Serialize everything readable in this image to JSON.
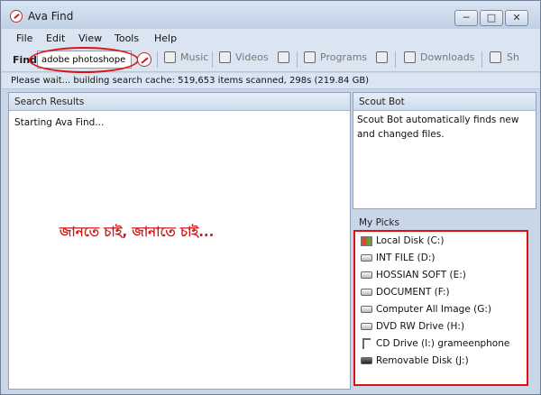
{
  "window": {
    "title": "Ava Find",
    "controls": {
      "minimize": "─",
      "maximize": "□",
      "close": "✕"
    }
  },
  "menu": [
    "File",
    "Edit",
    "View",
    "Tools",
    "Help"
  ],
  "toolbar": {
    "find_label": "Find",
    "search_value": "adobe photoshope",
    "buttons": [
      "Music",
      "Videos",
      "Programs",
      "Downloads",
      "Sh"
    ]
  },
  "status": "Please wait... building search cache: 519,653 items scanned, 298s (219.84 GB)",
  "results": {
    "title": "Search Results",
    "message": "Starting Ava Find...",
    "annotation": "জানতে চাই,  জানাতে চাই..."
  },
  "scout": {
    "title": "Scout Bot",
    "text": "Scout Bot automatically finds new and changed files."
  },
  "picks": {
    "title": "My Picks",
    "items": [
      {
        "label": "Local Disk (C:)",
        "icon": "windows-drive-icon"
      },
      {
        "label": "INT FILE (D:)",
        "icon": "hard-drive-icon"
      },
      {
        "label": "HOSSIAN SOFT (E:)",
        "icon": "hard-drive-icon"
      },
      {
        "label": "DOCUMENT (F:)",
        "icon": "hard-drive-icon"
      },
      {
        "label": "Computer All Image (G:)",
        "icon": "hard-drive-icon"
      },
      {
        "label": "DVD RW Drive (H:)",
        "icon": "dvd-drive-icon"
      },
      {
        "label": "CD Drive (I:) grameenphone",
        "icon": "usb-icon"
      },
      {
        "label": "Removable Disk (J:)",
        "icon": "removable-disk-icon"
      }
    ]
  },
  "colors": {
    "highlight": "#e01010",
    "window_bg": "#c8d6e8"
  }
}
